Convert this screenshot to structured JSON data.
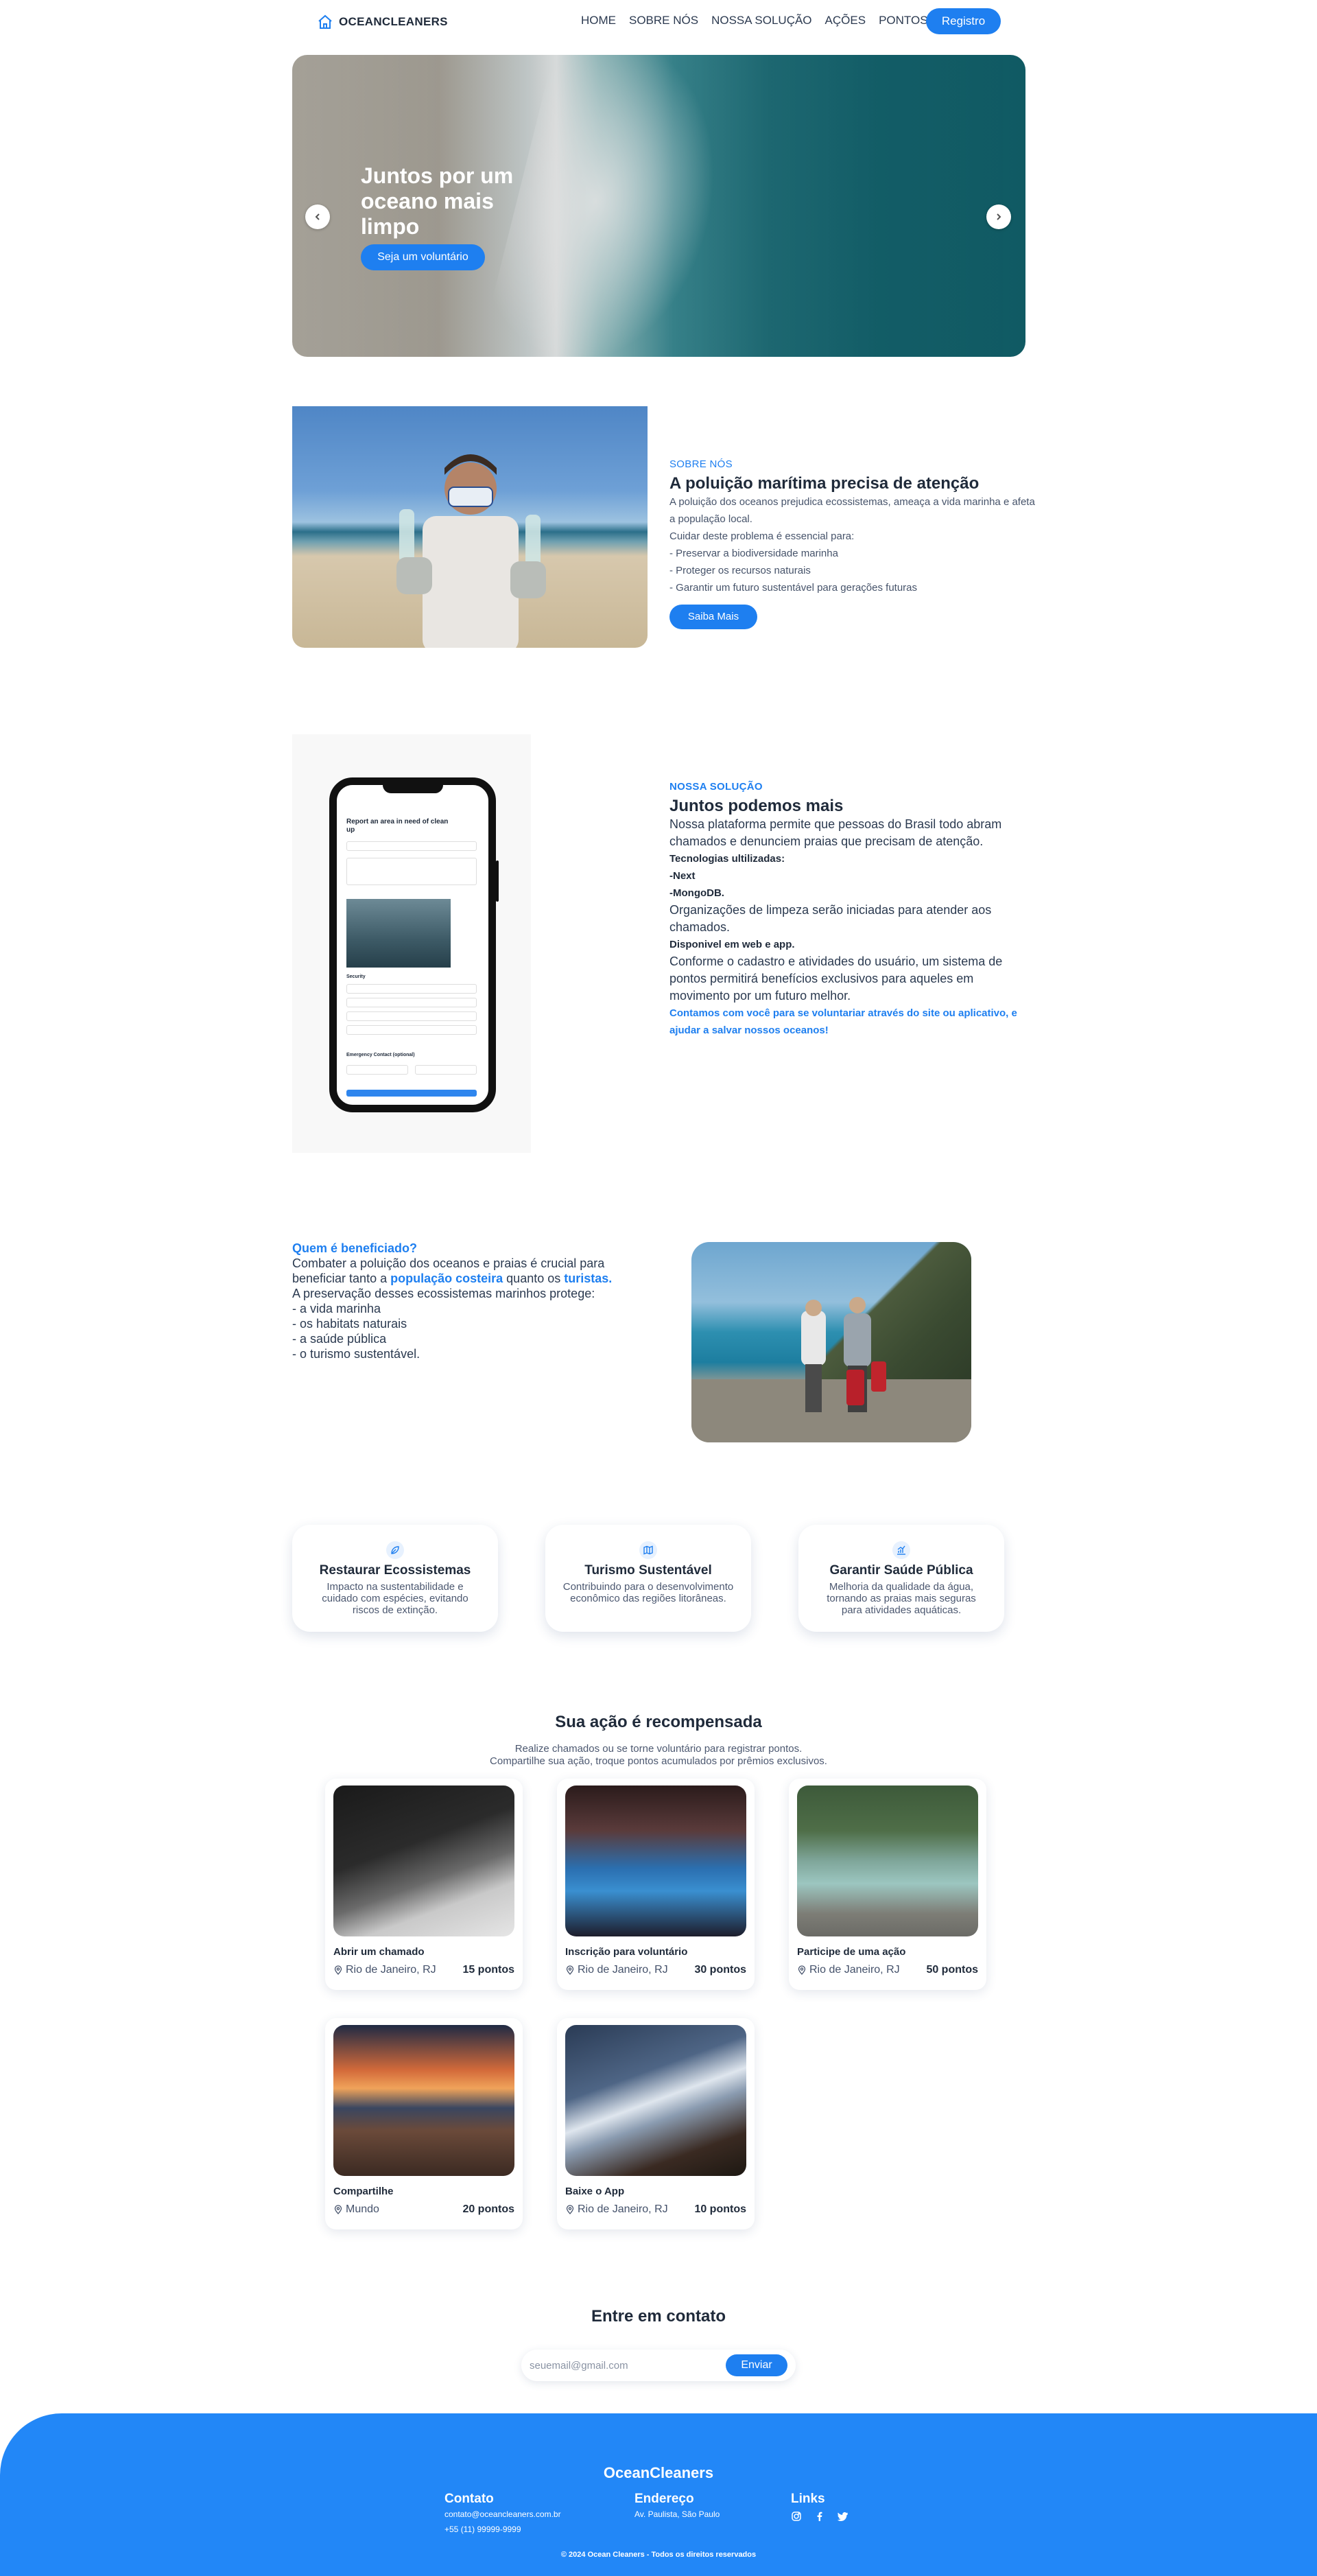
{
  "nav": {
    "brand": "OCEANCLEANERS",
    "links": [
      "HOME",
      "SOBRE NÓS",
      "NOSSA SOLUÇÃO",
      "AÇÕES",
      "PONTOS"
    ],
    "register": "Registro"
  },
  "hero": {
    "title": "Juntos por um oceano mais limpo",
    "button": "Seja um voluntário"
  },
  "about": {
    "kicker": "SOBRE NÓS",
    "title": "A poluição marítima precisa de atenção",
    "lines": [
      "A poluição dos oceanos prejudica ecossistemas, ameaça a vida marinha e afeta a população local.",
      "Cuidar deste problema é essencial para:",
      "- Preservar a biodiversidade marinha",
      "- Proteger os recursos naturais",
      "- Garantir um futuro sustentável para gerações futuras"
    ],
    "button": "Saiba Mais"
  },
  "phone_screen": {
    "title": "Report an area in need of clean up",
    "section_label": "Security",
    "contact_label": "Emergency Contact (optional)",
    "submit_label": "Submit report"
  },
  "solution": {
    "kicker": "NOSSA SOLUÇÃO",
    "title": "Juntos podemos mais",
    "p1": "Nossa plataforma permite que pessoas do Brasil todo abram chamados e denunciem praias que precisam de atenção.",
    "tech_label": "Tecnologias ultilizadas:",
    "tech1": "-Next",
    "tech2": "-MongoDB.",
    "p2": "Organizações de limpeza serão iniciadas para atender aos chamados.",
    "available": "Disponivel em web e app.",
    "p3": "Conforme o cadastro e atividades do usuário, um sistema de pontos permitirá benefícios exclusivos para aqueles em movimento por um futuro melhor.",
    "cta": "Contamos com você para se voluntariar através do site ou aplicativo, e ajudar a salvar nossos oceanos!"
  },
  "benefited": {
    "question": "Quem é beneficiado?",
    "l1a": "Combater a poluição dos oceanos e praias é crucial para beneficiar tanto a ",
    "l1b": "população costeira",
    "l1c": " quanto os ",
    "l1d": "turistas.",
    "l2": "A preservação desses ecossistemas marinhos protege:",
    "items": [
      "- a vida marinha",
      "- os habitats naturais",
      "- a saúde pública",
      "- o turismo sustentável."
    ]
  },
  "cards": [
    {
      "icon": "leaf-icon",
      "title": "Restaurar Ecossistemas",
      "desc": "Impacto na sustentabilidade e cuidado com espécies, evitando riscos de extinção."
    },
    {
      "icon": "map-icon",
      "title": "Turismo Sustentável",
      "desc": "Contribuindo para o desenvolvimento econômico das regiões litorâneas."
    },
    {
      "icon": "chart-icon",
      "title": "Garantir Saúde Pública",
      "desc": "Melhoria da qualidade da água, tornando as praias mais seguras para atividades aquáticas."
    }
  ],
  "rewards": {
    "title": "Sua ação é recompensada",
    "sub1": "Realize chamados ou se torne voluntário para registrar pontos.",
    "sub2": "Compartilhe sua ação, troque pontos acumulados por prêmios exclusivos.",
    "items": [
      {
        "name": "Abrir um chamado",
        "location": "Rio de Janeiro, RJ",
        "points": "15 pontos"
      },
      {
        "name": "Inscrição para voluntário",
        "location": "Rio de Janeiro, RJ",
        "points": "30 pontos"
      },
      {
        "name": "Participe de uma ação",
        "location": "Rio de Janeiro, RJ",
        "points": "50 pontos"
      },
      {
        "name": "Compartilhe",
        "location": "Mundo",
        "points": "20 pontos"
      },
      {
        "name": "Baixe o App",
        "location": "Rio de Janeiro, RJ",
        "points": "10 pontos"
      }
    ]
  },
  "contact": {
    "title": "Entre em contato",
    "placeholder": "seuemail@gmail.com",
    "button": "Enviar"
  },
  "footer": {
    "brand": "OceanCleaners",
    "contact_title": "Contato",
    "email": "contato@oceancleaners.com.br",
    "phone": "+55 (11) 99999-9999",
    "address_title": "Endereço",
    "address": "Av. Paulista, São Paulo",
    "links_title": "Links",
    "copyright": "© 2024 Ocean Cleaners - Todos os direitos reservados"
  },
  "colors": {
    "accent": "#1e7ff0",
    "footer": "#2287f7",
    "text": "#1f2a3a"
  }
}
